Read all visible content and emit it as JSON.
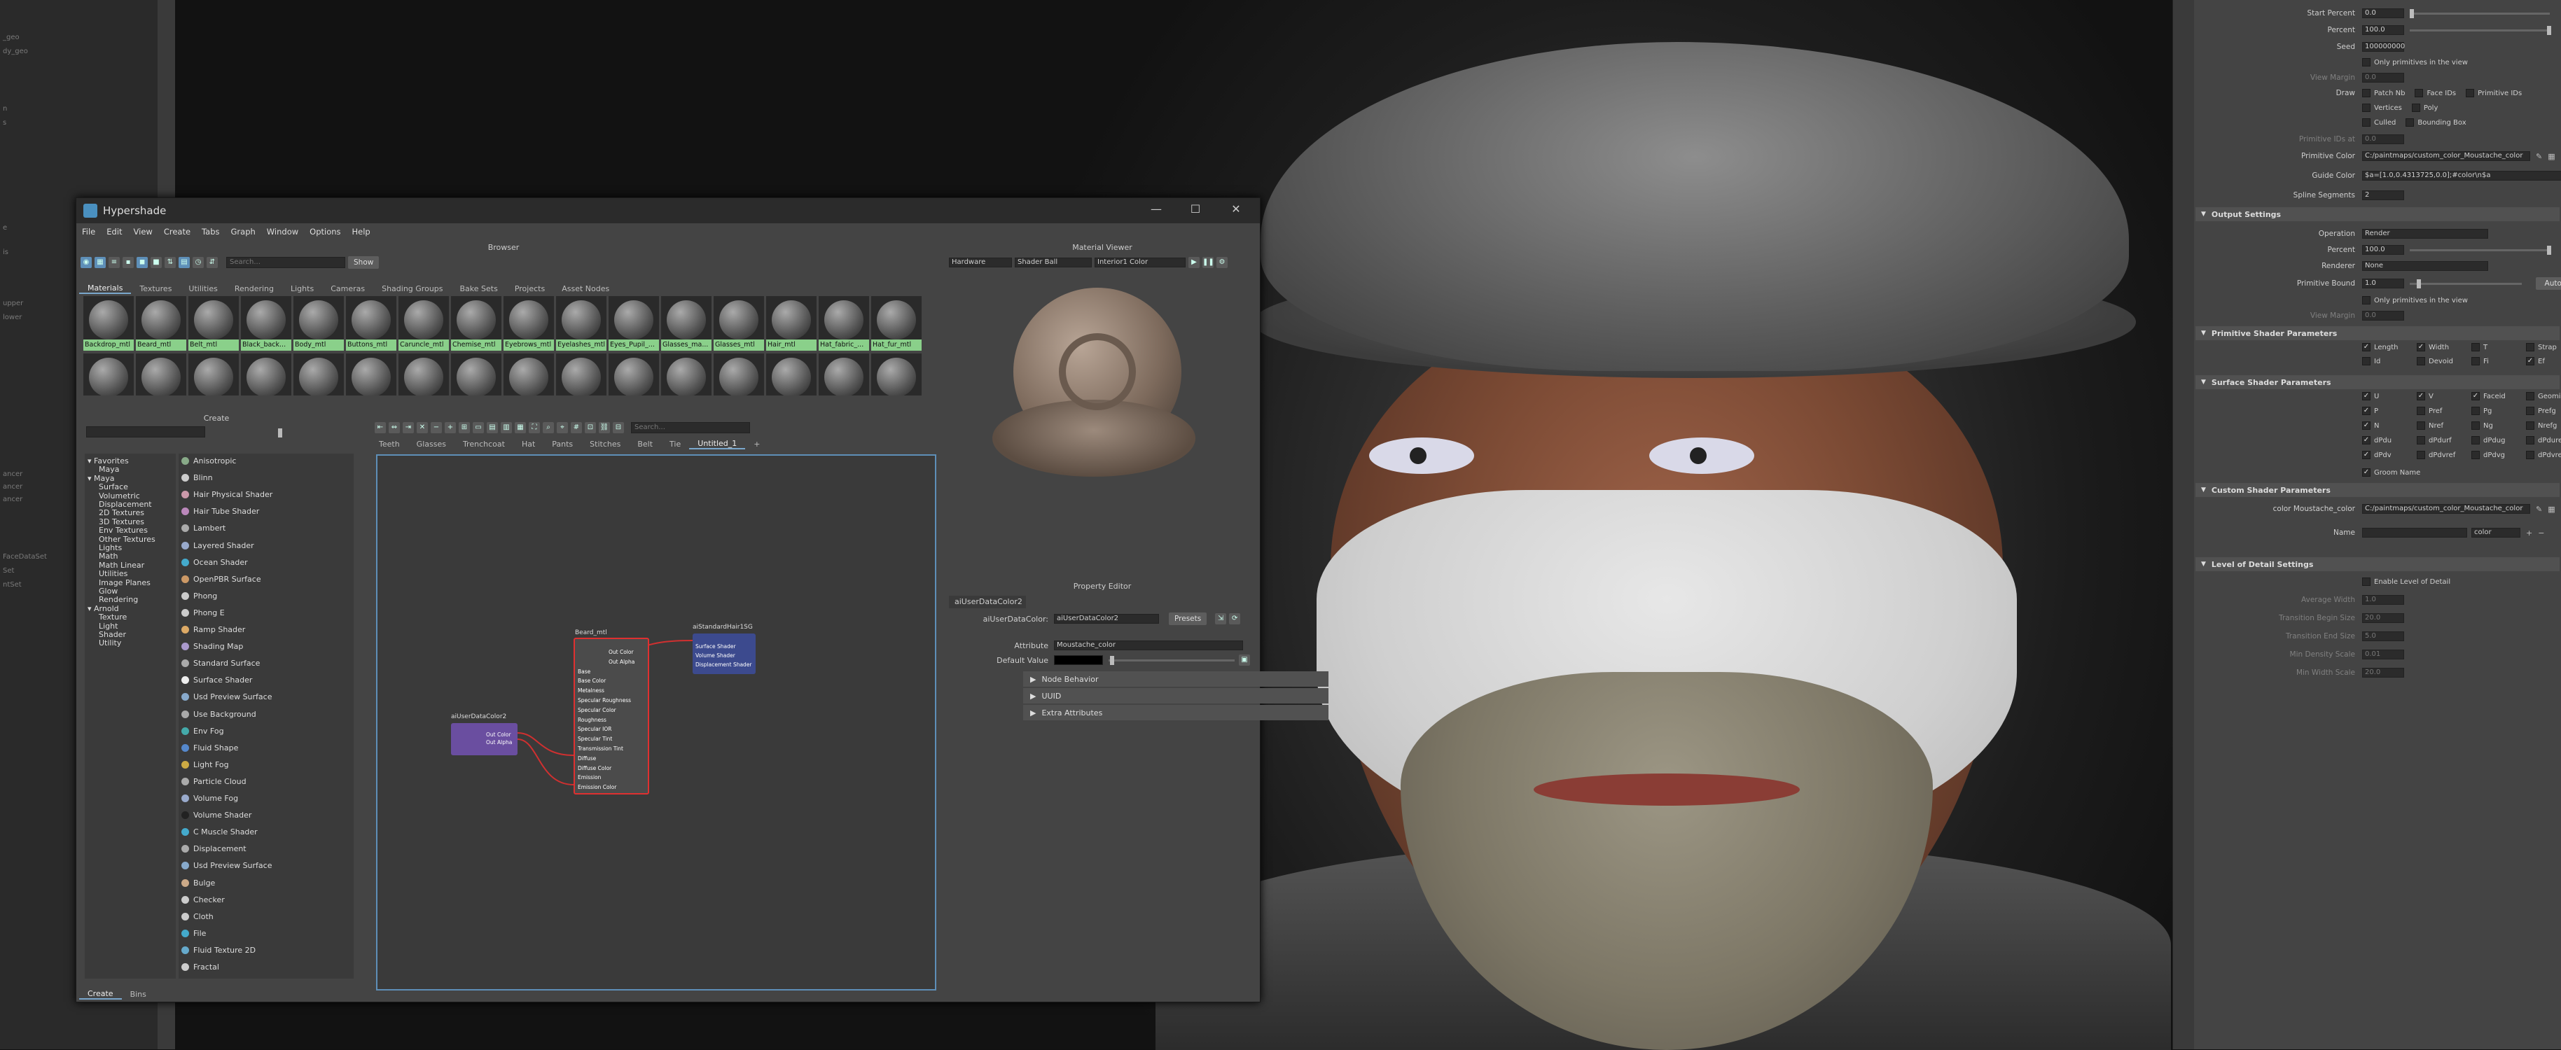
{
  "outliner": {
    "items": [
      "_geo",
      "dy_geo",
      "n",
      "s",
      "e",
      "is",
      "upper",
      "lower",
      "ancer",
      "ancer",
      "ancer",
      "FaceDataSet",
      "Set",
      "ntSet"
    ]
  },
  "attribute_editor": {
    "rows_top": [
      {
        "label": "Start Percent",
        "value": "0.0"
      },
      {
        "label": "Percent",
        "value": "100.0"
      },
      {
        "label": "Seed",
        "value": "100000000"
      }
    ],
    "only_primitives": "Only primitives in the view",
    "view_margin": {
      "label": "View Margin",
      "value": "0.0"
    },
    "draw": {
      "label": "Draw",
      "options": [
        [
          "Patch Nb",
          "Face IDs",
          "Primitive IDs"
        ],
        [
          "Vertices",
          "Poly",
          ""
        ],
        [
          "Culled",
          "Bounding Box",
          ""
        ]
      ]
    },
    "primitive_ids_at": {
      "label": "Primitive IDs at",
      "value": "0.0"
    },
    "primitive_color": {
      "label": "Primitive Color",
      "value": "C:/paintmaps/custom_color_Moustache_color"
    },
    "guide_color": {
      "label": "Guide Color",
      "value": "$a=[1.0,0.4313725,0.0];#color\\n$a"
    },
    "spline_segments": {
      "label": "Spline Segments",
      "value": "2"
    },
    "output_settings": {
      "title": "Output Settings",
      "operation": {
        "label": "Operation",
        "value": "Render"
      },
      "percent": {
        "label": "Percent",
        "value": "100.0"
      },
      "renderer": {
        "label": "Renderer",
        "value": "None"
      },
      "primitive_bound": {
        "label": "Primitive Bound",
        "value": "1.0"
      },
      "auto_set": "Auto Set",
      "only_primitives": "Only primitives in the view",
      "view_margin": {
        "label": "View Margin",
        "value": "0.0"
      }
    },
    "primitive_shader": {
      "title": "Primitive Shader Parameters",
      "options": [
        "Length",
        "Width",
        "T",
        "Strap",
        "Id",
        "Devoid",
        "Fi",
        "Ef"
      ],
      "checked": [
        true,
        true,
        false,
        false,
        false,
        false,
        false,
        true
      ]
    },
    "surface_shader": {
      "title": "Surface Shader Parameters",
      "rows": [
        [
          "U",
          "V",
          "Faceid",
          "Geomid"
        ],
        [
          "P",
          "Pref",
          "Pg",
          "Prefg"
        ],
        [
          "N",
          "Nref",
          "Ng",
          "Nrefg"
        ],
        [
          "dPdu",
          "dPdurf",
          "dPdug",
          "dPdurefg"
        ],
        [
          "dPdv",
          "dPdvref",
          "dPdvg",
          "dPdvrefg"
        ]
      ],
      "checked": [
        [
          true,
          true,
          true,
          false
        ],
        [
          true,
          false,
          false,
          false
        ],
        [
          true,
          false,
          false,
          false
        ],
        [
          true,
          false,
          false,
          false
        ],
        [
          true,
          false,
          false,
          false
        ]
      ],
      "groom_name": "Groom Name"
    },
    "custom_shader": {
      "title": "Custom Shader Parameters",
      "row_label": "color Moustache_color",
      "row_value": "C:/paintmaps/custom_color_Moustache_color",
      "name_label": "Name",
      "type_value": "color"
    },
    "lod": {
      "title": "Level of Detail Settings",
      "enable": "Enable Level of Detail",
      "rows": [
        {
          "label": "Average Width",
          "value": "1.0"
        },
        {
          "label": "Transition Begin Size",
          "value": "20.0"
        },
        {
          "label": "Transition End Size",
          "value": "5.0"
        },
        {
          "label": "Min Density Scale",
          "value": "0.01"
        },
        {
          "label": "Min Width Scale",
          "value": "20.0"
        }
      ]
    }
  },
  "hypershade": {
    "title": "Hypershade",
    "menu": [
      "File",
      "Edit",
      "View",
      "Create",
      "Tabs",
      "Graph",
      "Window",
      "Options",
      "Help"
    ],
    "browser": {
      "header": "Browser",
      "search_placeholder": "Search...",
      "show_label": "Show",
      "tabs": [
        "Materials",
        "Textures",
        "Utilities",
        "Rendering",
        "Lights",
        "Cameras",
        "Shading Groups",
        "Bake Sets",
        "Projects",
        "Asset Nodes"
      ],
      "swatches": [
        "Backdrop_mtl",
        "Beard_mtl",
        "Belt_mtl",
        "Black_back...",
        "Body_mtl",
        "Buttons_mtl",
        "Caruncle_mtl",
        "Chemise_mtl",
        "Eyebrows_mtl",
        "Eyelashes_mtl",
        "Eyes_Pupil_...",
        "Glasses_ma...",
        "Glasses_mtl",
        "Hair_mtl",
        "Hat_fabric_...",
        "Hat_fur_mtl"
      ]
    },
    "material_viewer": {
      "header": "Material Viewer",
      "renderer": "Hardware",
      "shape": "Shader Ball",
      "env": "Interior1 Color"
    },
    "create": {
      "header": "Create",
      "tree": [
        {
          "t": "Favorites",
          "d": 0
        },
        {
          "t": "Maya",
          "d": 1
        },
        {
          "t": "Maya",
          "d": 0
        },
        {
          "t": "Surface",
          "d": 1
        },
        {
          "t": "Volumetric",
          "d": 1
        },
        {
          "t": "Displacement",
          "d": 1
        },
        {
          "t": "2D Textures",
          "d": 1
        },
        {
          "t": "3D Textures",
          "d": 1
        },
        {
          "t": "Env Textures",
          "d": 1
        },
        {
          "t": "Other Textures",
          "d": 1
        },
        {
          "t": "Lights",
          "d": 1
        },
        {
          "t": "Math",
          "d": 1
        },
        {
          "t": "Math Linear",
          "d": 1
        },
        {
          "t": "Utilities",
          "d": 1
        },
        {
          "t": "Image Planes",
          "d": 1
        },
        {
          "t": "Glow",
          "d": 1
        },
        {
          "t": "Rendering",
          "d": 1
        },
        {
          "t": "Arnold",
          "d": 0
        },
        {
          "t": "Texture",
          "d": 1
        },
        {
          "t": "Light",
          "d": 1
        },
        {
          "t": "Shader",
          "d": 1
        },
        {
          "t": "Utility",
          "d": 1
        }
      ],
      "nodes": [
        "Anisotropic",
        "Blinn",
        "Hair Physical Shader",
        "Hair Tube Shader",
        "Lambert",
        "Layered Shader",
        "Ocean Shader",
        "OpenPBR Surface",
        "Phong",
        "Phong E",
        "Ramp Shader",
        "Shading Map",
        "Standard Surface",
        "Surface Shader",
        "Usd Preview Surface",
        "Use Background",
        "Env Fog",
        "Fluid Shape",
        "Light Fog",
        "Particle Cloud",
        "Volume Fog",
        "Volume Shader",
        "C Muscle Shader",
        "Displacement",
        "Usd Preview Surface",
        "Bulge",
        "Checker",
        "Cloth",
        "File",
        "Fluid Texture 2D",
        "Fractal"
      ],
      "bottom_tabs": [
        "Create",
        "Bins"
      ]
    },
    "graph": {
      "search_placeholder": "Search...",
      "tabs": [
        "Teeth",
        "Glasses",
        "Trenchcoat",
        "Hat",
        "Pants",
        "Stitches",
        "Belt",
        "Tie",
        "Untitled_1",
        "+"
      ],
      "nodes": {
        "user": {
          "title": "aiUserDataColor2",
          "ports": [
            "Out Color",
            "Out Alpha"
          ]
        },
        "beard": {
          "title": "Beard_mtl",
          "ports": [
            "Out Color",
            "Out Alpha",
            "Base",
            "Base Color",
            "Metalness",
            "Specular Roughness",
            "Specular Color",
            "Roughness",
            "Specular IOR",
            "Specular Tint",
            "Transmission Tint",
            "Diffuse",
            "Diffuse Color",
            "Emission",
            "Emission Color"
          ]
        },
        "sg": {
          "title": "aiStandardHair1SG",
          "ports": [
            "Surface Shader",
            "Volume Shader",
            "Displacement Shader"
          ]
        }
      }
    },
    "property_editor": {
      "header": "Property Editor",
      "node_tab": "aiUserDataColor2",
      "node_label": "aiUserDataColor:",
      "node_value": "aiUserDataColor2",
      "presets": "Presets",
      "attribute_label": "Attribute",
      "attribute_value": "Moustache_color",
      "default_label": "Default Value",
      "sections": [
        "Node Behavior",
        "UUID",
        "Extra Attributes"
      ]
    }
  }
}
